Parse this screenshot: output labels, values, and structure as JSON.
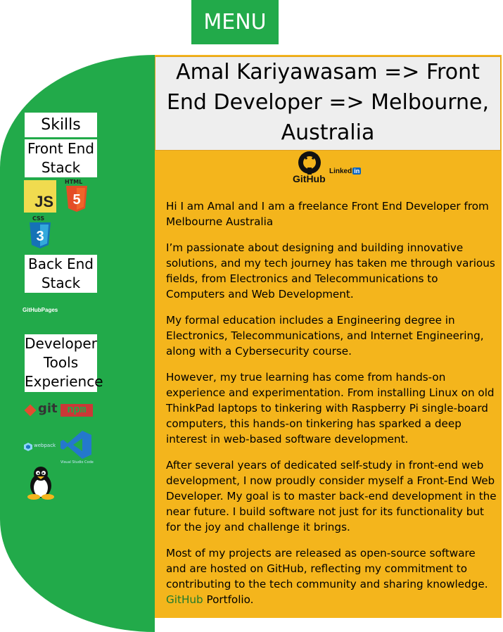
{
  "menu": {
    "label": "MENU"
  },
  "header": {
    "title": "Amal Kariyawasam => Front End Developer => Melbourne, Australia"
  },
  "social": {
    "github_label": "GitHub",
    "linkedin_label": "Linked",
    "linkedin_badge": "in"
  },
  "sidebar": {
    "skills_label": "Skills",
    "frontend_label": "Front End Stack",
    "js_label": "JS",
    "html_label": "HTML",
    "css_label": "CSS",
    "backend_label": "Back End Stack",
    "github_pages_label": "GitHubPages",
    "devtools_label": "Developer Tools Experience",
    "git_label": "git",
    "npm_label": "npm",
    "webpack_label": "webpack",
    "vscode_label": "Visual Studio Code"
  },
  "content": {
    "p1": "Hi I am Amal and I am a freelance Front End Developer from Melbourne Australia",
    "p2": "I’m passionate about designing and building innovative solutions, and my tech journey has taken me through various fields, from Electronics and Telecommunications to Computers and Web Development.",
    "p3": "My formal education includes a Engineering degree in Electronics, Telecommunications, and Internet Engineering, along with a Cybersecurity course.",
    "p4": "However, my true learning has come from hands-on experience and experimentation. From installing Linux on old ThinkPad laptops to tinkering with Raspberry Pi single-board computers, this hands-on tinkering has sparked a deep interest in web-based software development.",
    "p5": "After several years of dedicated self-study in front-end web development, I now proudly consider myself a Front-End Web Developer. My goal is to master back-end development in the near future. I build software not just for its functionality but for the joy and challenge it brings.",
    "p6": "Most of my projects are released as open-source software and are hosted on GitHub, reflecting my commitment to contributing to the tech community and sharing knowledge.",
    "github_link": "GitHub",
    "portfolio_suffix": " Portfolio."
  },
  "colors": {
    "accent_green": "#22aa4a",
    "main_bg": "#f4b51c"
  }
}
